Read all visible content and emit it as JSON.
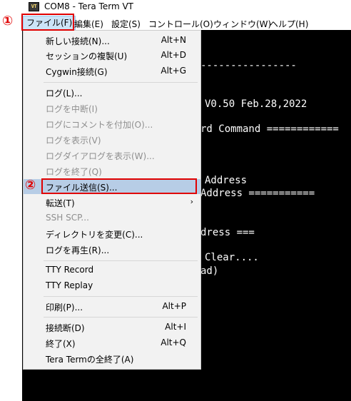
{
  "window": {
    "icon_text": "VT",
    "title": "COM8 - Tera Term VT"
  },
  "menubar": [
    {
      "label": "ファイル(F)"
    },
    {
      "label": "編集(E)"
    },
    {
      "label": "設定(S)"
    },
    {
      "label": "コントロール(O)"
    },
    {
      "label": "ウィンドウ(W)"
    },
    {
      "label": "ヘルプ(H)"
    }
  ],
  "terminal_lines": [
    "----------------",
    "V0.50 Feb.28,2022",
    "rd Command ============",
    "Address",
    "Address ===========",
    "dress ===",
    "Clear....",
    "ad)"
  ],
  "file_menu": {
    "items": [
      {
        "label": "新しい接続(N)...",
        "accel": "Alt+N",
        "enabled": true
      },
      {
        "label": "セッションの複製(U)",
        "accel": "Alt+D",
        "enabled": true
      },
      {
        "label": "Cygwin接続(G)",
        "accel": "Alt+G",
        "enabled": true
      },
      {
        "label": "ログ(L)...",
        "accel": "",
        "enabled": true
      },
      {
        "label": "ログを中断(I)",
        "accel": "",
        "enabled": false
      },
      {
        "label": "ログにコメントを付加(O)...",
        "accel": "",
        "enabled": false
      },
      {
        "label": "ログを表示(V)",
        "accel": "",
        "enabled": false
      },
      {
        "label": "ログダイアログを表示(W)...",
        "accel": "",
        "enabled": false
      },
      {
        "label": "ログを終了(Q)",
        "accel": "",
        "enabled": false
      },
      {
        "label": "ファイル送信(S)...",
        "accel": "",
        "enabled": true
      },
      {
        "label": "転送(T)",
        "accel": "",
        "enabled": true,
        "submenu_arrow": "›"
      },
      {
        "label": "SSH SCP...",
        "accel": "",
        "enabled": false
      },
      {
        "label": "ディレクトリを変更(C)...",
        "accel": "",
        "enabled": true
      },
      {
        "label": "ログを再生(R)...",
        "accel": "",
        "enabled": true
      },
      {
        "label": "TTY Record",
        "accel": "",
        "enabled": true
      },
      {
        "label": "TTY Replay",
        "accel": "",
        "enabled": true
      },
      {
        "label": "印刷(P)...",
        "accel": "Alt+P",
        "enabled": true
      },
      {
        "label": "接続断(D)",
        "accel": "Alt+I",
        "enabled": true
      },
      {
        "label": "終了(X)",
        "accel": "Alt+Q",
        "enabled": true
      },
      {
        "label": "Tera Termの全終了(A)",
        "accel": "",
        "enabled": true
      }
    ]
  },
  "annotations": {
    "marker1": "①",
    "marker2": "②"
  },
  "colors": {
    "annotation_red": "#e00000",
    "highlight": "#b7cde6",
    "terminal_bg": "#000000"
  }
}
